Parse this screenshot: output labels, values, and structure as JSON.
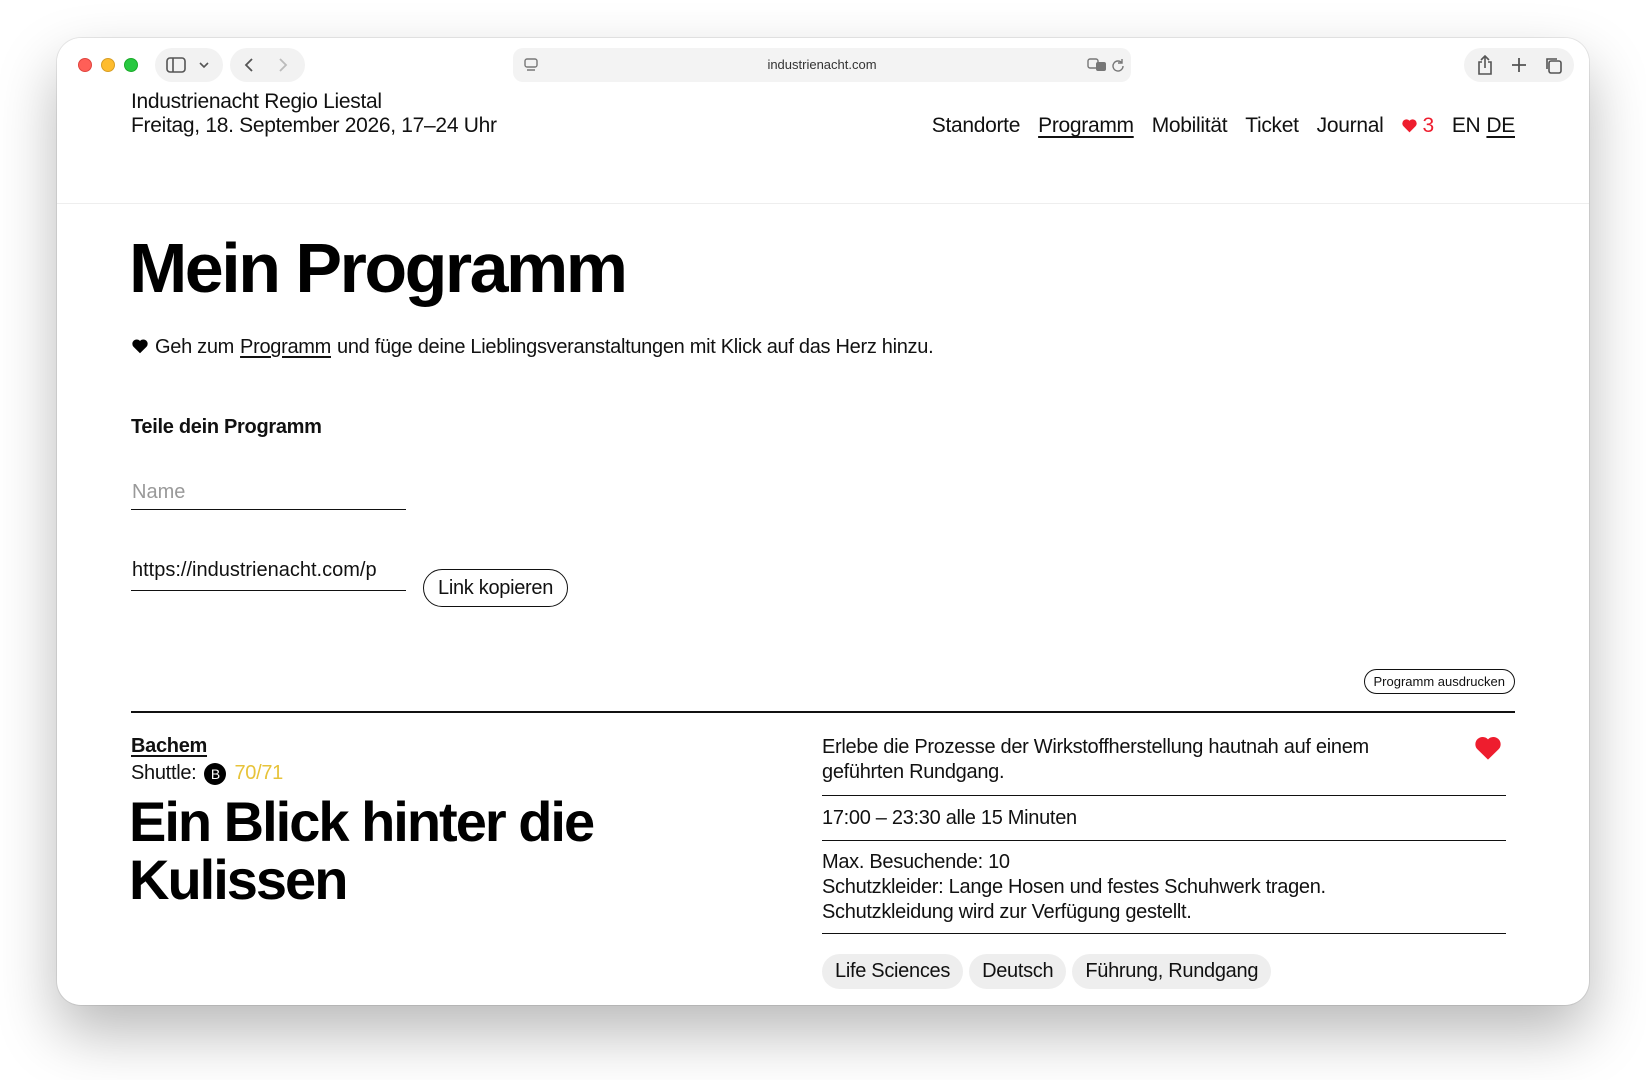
{
  "browser": {
    "url": "industrienacht.com"
  },
  "header": {
    "event_title": "Industrienacht Regio Liestal",
    "event_date": "Freitag, 18. September 2026, 17–24 Uhr",
    "nav": [
      {
        "label": "Standorte"
      },
      {
        "label": "Programm"
      },
      {
        "label": "Mobilität"
      },
      {
        "label": "Ticket"
      },
      {
        "label": "Journal"
      }
    ],
    "favorites_count": "3",
    "lang_en": "EN",
    "lang_de": "DE"
  },
  "main": {
    "title": "Mein Programm",
    "intro_before": "Geh zum",
    "intro_link": "Programm",
    "intro_after": "und füge deine Lieblingsveranstaltungen mit Klick auf das Herz hinzu.",
    "share_title": "Teile dein Programm",
    "name_placeholder": "Name",
    "share_link_value": "https://industrienacht.com/p",
    "copy_button": "Link kopieren",
    "print_button": "Programm ausdrucken"
  },
  "event": {
    "location": "Bachem",
    "shuttle_label": "Shuttle:",
    "shuttle_badge": "B",
    "shuttle_lines": "70/71",
    "title": "Ein Blick hinter die Kulissen",
    "description": "Erlebe die Prozesse der Wirkstoffherstellung hautnah auf einem geführten Rundgang.",
    "time": "17:00 – 23:30  alle 15 Minuten",
    "info_1": "Max. Besuchende: 10",
    "info_2": "Schutzkleider: Lange Hosen und festes Schuhwerk tragen.",
    "info_3": "Schutzkleidung wird zur Verfügung gestellt.",
    "tags": [
      "Life Sciences",
      "Deutsch",
      "Führung, Rundgang"
    ]
  },
  "colors": {
    "accent_red": "#ee1d2e",
    "shuttle_yellow": "#e7c33a"
  }
}
